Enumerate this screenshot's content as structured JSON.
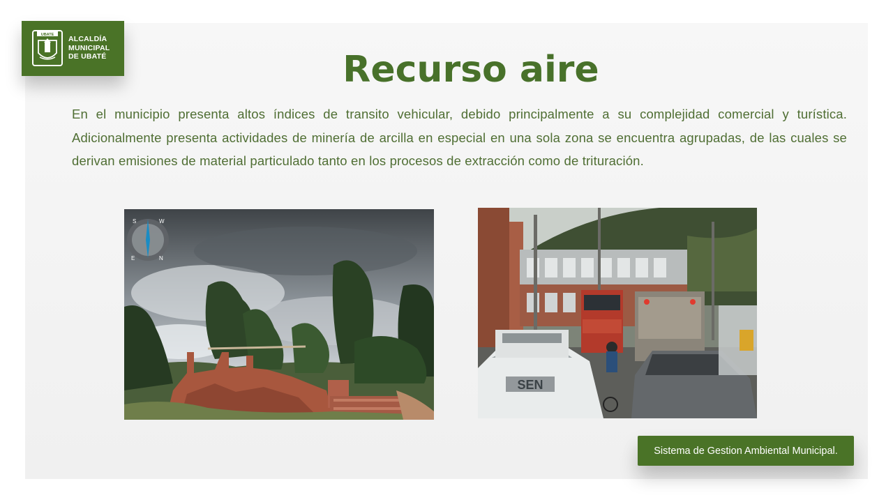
{
  "logo": {
    "emblem_label": "UBATÉ",
    "line1": "ALCALDÍA",
    "line2": "MUNICIPAL",
    "line3": "DE UBATÉ"
  },
  "slide": {
    "title": "Recurso aire",
    "paragraph": "En el municipio presenta altos índices de transito vehicular, debido principalmente a su complejidad comercial y turística. Adicionalmente presenta actividades de minería de arcilla en especial en una sola zona se encuentra agrupadas, de las cuales se derivan emisiones de material particulado tanto en los procesos de extracción como de trituración."
  },
  "photos": {
    "left_icon": "compass-icon",
    "compass_letters": [
      "S",
      "W",
      "E",
      "N"
    ],
    "right_sign_text": "SEN"
  },
  "footer": {
    "badge": "Sistema de Gestion Ambiental Municipal."
  },
  "colors": {
    "brand_green": "#4a7327",
    "title_green": "#48712a",
    "text_green": "#4f6e33"
  }
}
